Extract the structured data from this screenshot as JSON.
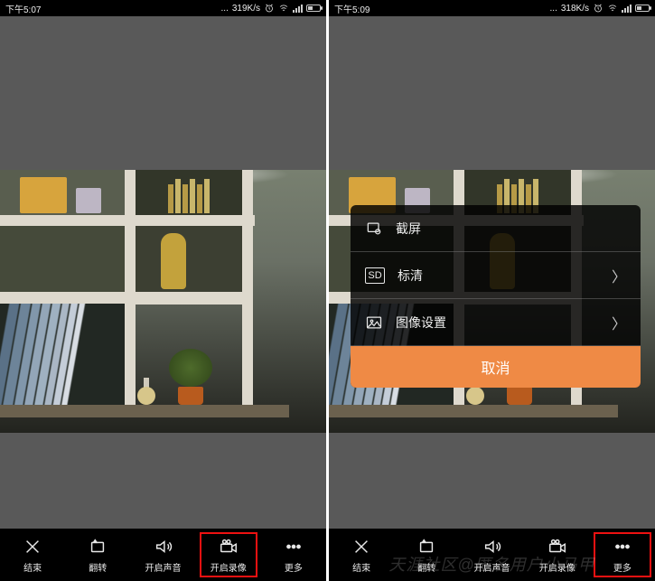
{
  "left": {
    "status": {
      "time": "下午5:07",
      "speed": "319K/s"
    },
    "toolbar": [
      {
        "id": "end",
        "label": "结束"
      },
      {
        "id": "flip",
        "label": "翻转"
      },
      {
        "id": "sound",
        "label": "开启声音"
      },
      {
        "id": "record",
        "label": "开启录像",
        "highlighted": true
      },
      {
        "id": "more",
        "label": "更多"
      }
    ]
  },
  "right": {
    "status": {
      "time": "下午5:09",
      "speed": "318K/s"
    },
    "popup": {
      "items": [
        {
          "id": "screenshot",
          "label": "截屏",
          "chevron": false
        },
        {
          "id": "quality",
          "label": "标清",
          "chevron": true,
          "badge": "SD"
        },
        {
          "id": "image-set",
          "label": "图像设置",
          "chevron": true
        }
      ],
      "cancel": "取消"
    },
    "toolbar": [
      {
        "id": "end",
        "label": "结束"
      },
      {
        "id": "flip",
        "label": "翻转"
      },
      {
        "id": "sound",
        "label": "开启声音"
      },
      {
        "id": "record",
        "label": "开启录像"
      },
      {
        "id": "more",
        "label": "更多",
        "highlighted": true
      }
    ]
  },
  "watermark": "天涯社区@匿名用户小马甲"
}
